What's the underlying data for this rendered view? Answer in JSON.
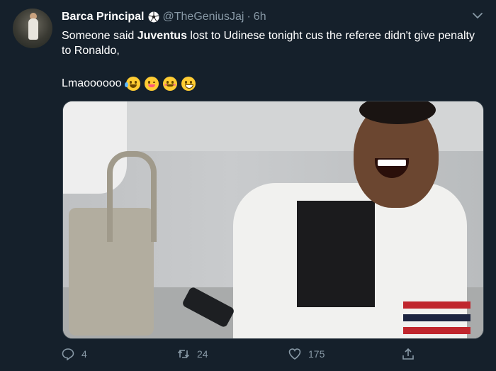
{
  "tweet": {
    "author_name": "Barca Principal",
    "handle": "@TheGeniusJaj",
    "separator": "·",
    "time": "6h",
    "text_before": "Someone said ",
    "text_bold": "Juventus",
    "text_after": " lost to Udinese tonight cus the referee didn't give penalty to Ronaldo,",
    "text_second": "Lmaoooooo",
    "emojis": [
      "face-with-tears-of-joy",
      "winking-face-with-tongue",
      "smiling-face-with-smiling-eyes",
      "grinning-squinting-face"
    ]
  },
  "actions": {
    "reply_count": "4",
    "retweet_count": "24",
    "like_count": "175"
  },
  "colors": {
    "background": "#15202b",
    "secondary_text": "#8899a6"
  },
  "icons": [
    "soccer-ball-icon",
    "chevron-down-icon",
    "reply-icon",
    "retweet-icon",
    "like-icon",
    "share-icon"
  ]
}
